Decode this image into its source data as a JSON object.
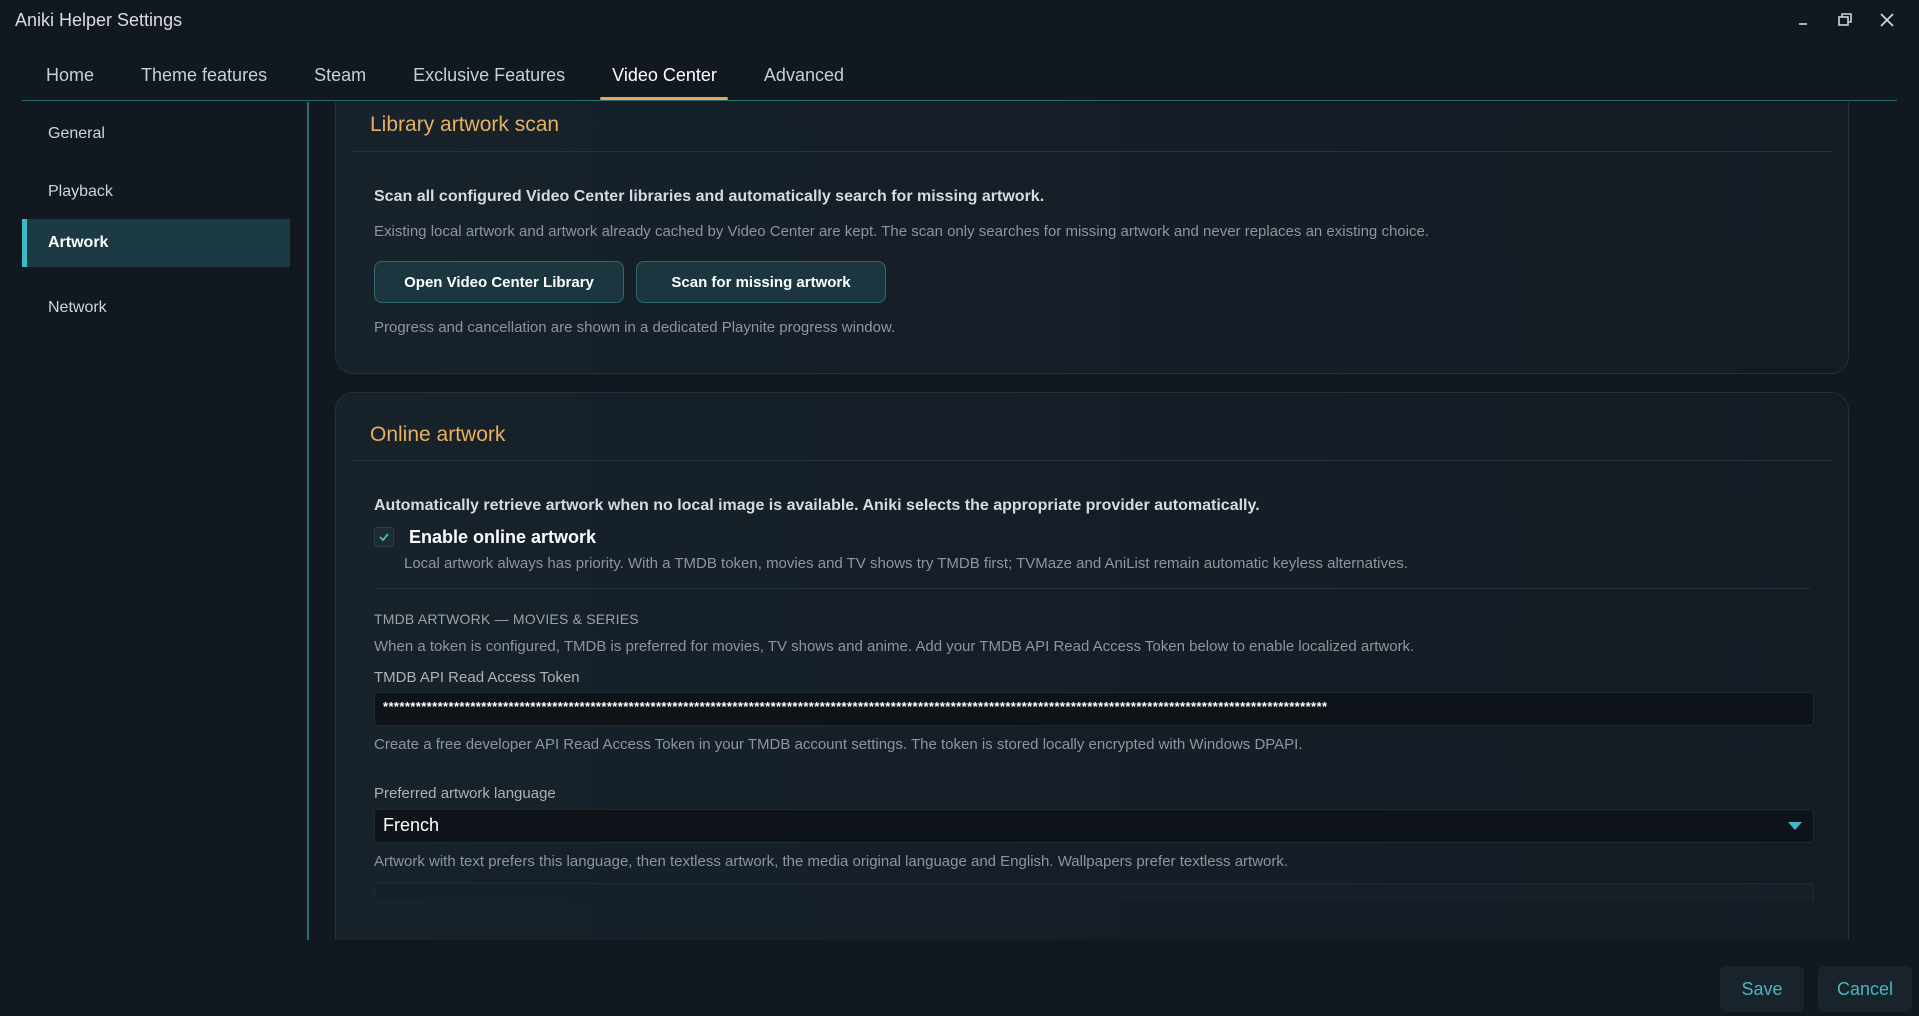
{
  "window": {
    "title": "Aniki Helper Settings",
    "controls": [
      "minimize-icon",
      "restore-icon",
      "close-icon"
    ]
  },
  "tabs": [
    {
      "label": "Home",
      "active": false
    },
    {
      "label": "Theme features",
      "active": false
    },
    {
      "label": "Steam",
      "active": false
    },
    {
      "label": "Exclusive Features",
      "active": false
    },
    {
      "label": "Video Center",
      "active": true
    },
    {
      "label": "Advanced",
      "active": false
    }
  ],
  "sidebar": {
    "items": [
      {
        "label": "General",
        "active": false
      },
      {
        "label": "Playback",
        "active": false
      },
      {
        "label": "Artwork",
        "active": true
      },
      {
        "label": "Network",
        "active": false
      }
    ]
  },
  "library_scan": {
    "title": "Library artwork scan",
    "description": "Scan all configured Video Center libraries and automatically search for missing artwork.",
    "note": "Existing local artwork and artwork already cached by Video Center are kept. The scan only searches for missing artwork and never replaces an existing choice.",
    "open_library_label": "Open Video Center Library",
    "scan_label": "Scan for missing artwork",
    "progress_note": "Progress and cancellation are shown in a dedicated Playnite progress window."
  },
  "online_artwork": {
    "title": "Online artwork",
    "description": "Automatically retrieve artwork when no local image is available. Aniki selects the appropriate provider automatically.",
    "enable_label": "Enable online artwork",
    "enable_checked": true,
    "enable_note": "Local artwork always has priority. With a TMDB token, movies and TV shows try TMDB first; TVMaze and AniList remain automatic keyless alternatives.",
    "tmdb_caption": "TMDB ARTWORK — MOVIES & SERIES",
    "tmdb_description": "When a token is configured, TMDB is preferred for movies, TV shows and anime. Add your TMDB API Read Access Token below to enable localized artwork.",
    "token_label": "TMDB API Read Access Token",
    "token_value": "*****************************************************************************************************************************************************************************",
    "token_note": "Create a free developer API Read Access Token in your TMDB account settings. The token is stored locally encrypted with Windows DPAPI.",
    "language_label": "Preferred artwork language",
    "language_value": "French",
    "language_note": "Artwork with text prefers this language, then textless artwork, the media original language and English. Wallpapers prefer textless artwork."
  },
  "footer": {
    "save_label": "Save",
    "cancel_label": "Cancel"
  },
  "colors": {
    "accent_gold": "#e2a94e",
    "accent_teal": "#3fb8c9",
    "background": "#121820"
  }
}
